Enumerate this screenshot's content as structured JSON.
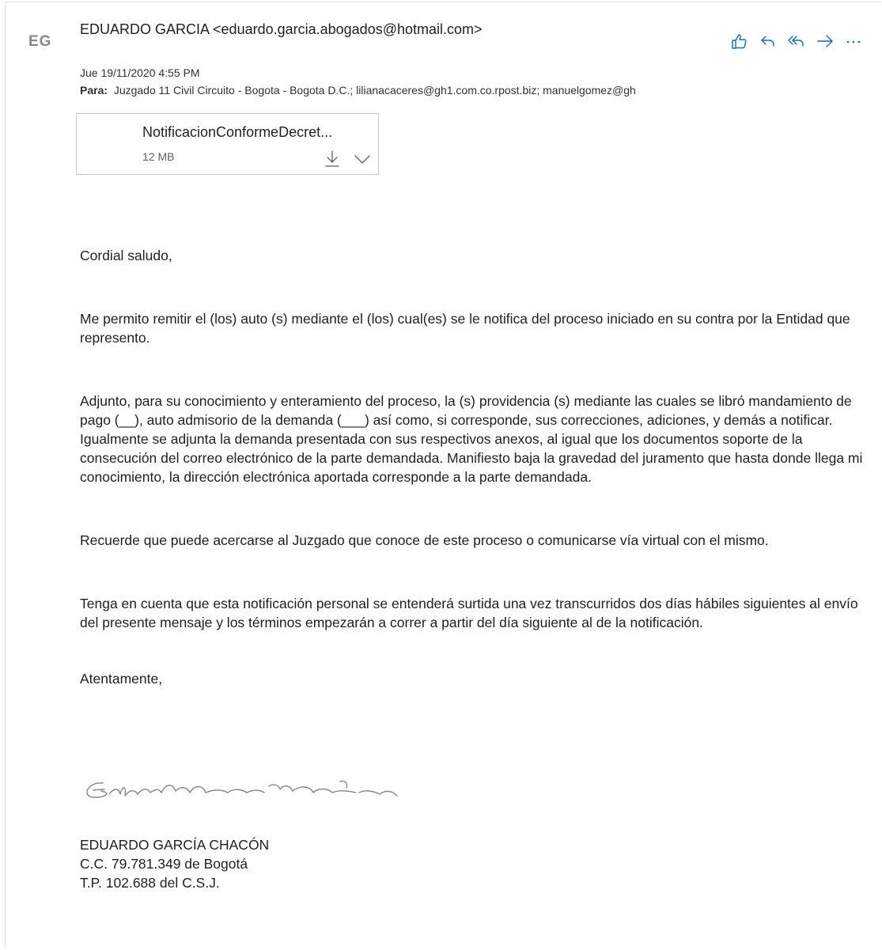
{
  "email": {
    "avatar_initials": "EG",
    "from": "EDUARDO GARCIA <eduardo.garcia.abogados@hotmail.com>",
    "date": "Jue 19/11/2020 4:55 PM",
    "to_label": "Para:",
    "to_value": "Juzgado 11 Civil Circuito - Bogota - Bogota D.C.; lilianacaceres@gh1.com.co.rpost.biz; manuelgomez@gh"
  },
  "actions": {
    "icons": [
      "like-icon",
      "reply-icon",
      "reply-all-icon",
      "forward-icon",
      "more-icon"
    ]
  },
  "attachment": {
    "name": "NotificacionConformeDecret...",
    "size": "12 MB"
  },
  "body": {
    "greeting": "Cordial saludo,",
    "p1": "Me permito remitir el (los) auto (s) mediante el (los) cual(es) se le notifica del proceso iniciado en su contra por la Entidad que represento.",
    "p2": "Adjunto, para su conocimiento y enteramiento del proceso, la (s) providencia (s) mediante las cuales se libró mandamiento  de pago (__), auto admisorio de la demanda (___) así como, si corresponde, sus correcciones, adiciones, y demás a notificar. Igualmente se adjunta la demanda presentada con sus respectivos anexos, al igual que los documentos soporte de la consecución del correo electrónico de la parte demandada. Manifiesto baja la gravedad del juramento que hasta donde llega mi conocimiento, la dirección electrónica aportada corresponde a la parte demandada.",
    "p3": "Recuerde que puede acercarse al Juzgado que conoce de este proceso o comunicarse vía virtual con el mismo.",
    "p4": "Tenga en cuenta que esta notificación personal se entenderá surtida una vez transcurridos dos días hábiles siguientes al envío del presente mensaje y los términos empezarán a correr a partir del día siguiente al de la notificación.",
    "closing": "Atentamente,",
    "sig_name": "EDUARDO GARCÍA CHACÓN",
    "sig_cc": "C.C. 79.781.349 de Bogotá",
    "sig_tp": "T.P. 102.688 del C.S.J."
  },
  "colors": {
    "icon": "#0f6cbd",
    "text": "#201f1e",
    "muted": "#605e5c"
  }
}
